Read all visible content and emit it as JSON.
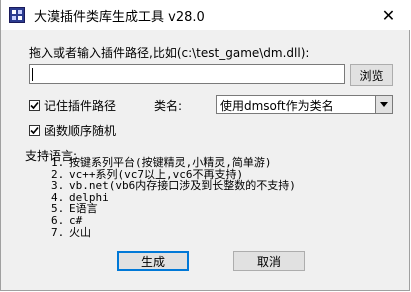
{
  "window": {
    "title": "大漠插件类库生成工具  v28.0",
    "close_symbol": "✕"
  },
  "form": {
    "prompt": "拖入或者输入插件路径,比如(c:\\test_game\\dm.dll):",
    "path_value": "",
    "browse_label": "浏览",
    "remember_path_label": "记住插件路径",
    "remember_path_checked": true,
    "classname_label": "类名:",
    "classname_selected": "使用dmsoft作为类名",
    "random_order_label": "函数顺序随机",
    "random_order_checked": true
  },
  "languages": {
    "title": "支持语言:",
    "items": [
      {
        "num": "1.",
        "text": "按键系列平台(按键精灵,小精灵,简单游)"
      },
      {
        "num": "2.",
        "text": "vc++系列(vc7以上,vc6不再支持)"
      },
      {
        "num": "3.",
        "text": "vb.net(vb6内存接口涉及到长整数的不支持)"
      },
      {
        "num": "4.",
        "text": "delphi"
      },
      {
        "num": "5.",
        "text": "E语言"
      },
      {
        "num": "6.",
        "text": "c#"
      },
      {
        "num": "7.",
        "text": "火山"
      }
    ]
  },
  "buttons": {
    "generate_label": "生成",
    "cancel_label": "取消"
  },
  "icons": {
    "app_icon": "app-logo-icon",
    "checkmark": "checkmark-icon",
    "dropdown": "chevron-down-icon"
  }
}
